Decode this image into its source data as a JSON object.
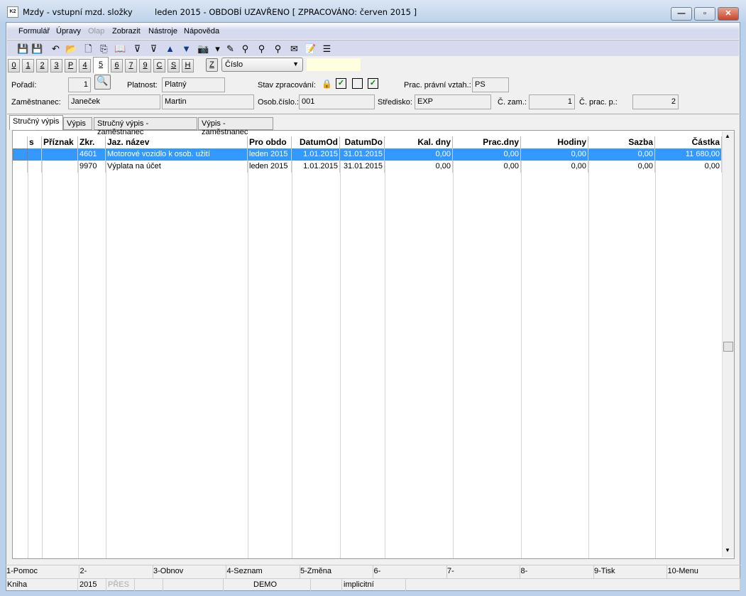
{
  "window": {
    "title": "Mzdy - vstupní mzd. složky",
    "status": "leden 2015 - OBDOBÍ UZAVŘENO [ ZPRACOVÁNO: červen 2015 ]",
    "logo": "K2",
    "min": "—",
    "max": "▫",
    "close": "✕"
  },
  "menu": [
    {
      "label": "Formulář",
      "enabled": true
    },
    {
      "label": "Úpravy",
      "enabled": true
    },
    {
      "label": "Olap",
      "enabled": false
    },
    {
      "label": "Zobrazit",
      "enabled": true
    },
    {
      "label": "Nástroje",
      "enabled": true
    },
    {
      "label": "Nápověda",
      "enabled": true
    }
  ],
  "toolbar": [
    {
      "icon": "save-icon",
      "glyph": "💾"
    },
    {
      "icon": "save-as-icon",
      "glyph": "💾"
    },
    {
      "icon": "undo-icon",
      "glyph": "↶"
    },
    {
      "icon": "open-folder-icon",
      "glyph": "📂"
    },
    {
      "icon": "new-document-icon",
      "glyph": "🗋"
    },
    {
      "icon": "copy-icon",
      "glyph": "⎘"
    },
    {
      "icon": "book-icon",
      "glyph": "📖"
    },
    {
      "icon": "filter-icon",
      "glyph": "⊽"
    },
    {
      "icon": "filter-list-icon",
      "glyph": "⊽"
    },
    {
      "icon": "arrow-up-icon",
      "glyph": "▲"
    },
    {
      "icon": "arrow-down-icon",
      "glyph": "▼"
    },
    {
      "icon": "camera-icon",
      "glyph": "📷"
    },
    {
      "icon": "dropdown-icon",
      "glyph": "▾"
    },
    {
      "icon": "excel-icon",
      "glyph": "✎"
    },
    {
      "icon": "binoculars-icon",
      "glyph": "⚲"
    },
    {
      "icon": "binoculars-next-icon",
      "glyph": "⚲"
    },
    {
      "icon": "binoculars-prev-icon",
      "glyph": "⚲"
    },
    {
      "icon": "mail-icon",
      "glyph": "✉"
    },
    {
      "icon": "edit-folder-icon",
      "glyph": "📝"
    },
    {
      "icon": "menu-lines-icon",
      "glyph": "☰"
    }
  ],
  "num_tabs": [
    "0",
    "1",
    "2",
    "3",
    "P",
    "4",
    "5",
    "6",
    "7",
    "9",
    "C",
    "S",
    "H"
  ],
  "active_num_tab": "5",
  "z_button": "Z",
  "sort_select": {
    "value": "Číslo"
  },
  "yellow_field": "",
  "form": {
    "poradi_label": "Pořadí:",
    "poradi": "1",
    "platnost_label": "Platnost:",
    "platnost": "Platný",
    "stav_label": "Stav zpracování:",
    "prac_vztah_label": "Prac. právní vztah.:",
    "prac_vztah": "PS",
    "zamestnanec_label": "Zaměstnanec:",
    "prijmeni": "Janeček",
    "jmeno": "Martin",
    "osob_label": "Osob.číslo.:",
    "osob": "001",
    "stredisko_label": "Středisko:",
    "stredisko": "EXP",
    "czam_label": "Č. zam.:",
    "czam": "1",
    "cprac_label": "Č. prac. p.:",
    "cprac": "2"
  },
  "inner_tabs": [
    "Stručný výpis",
    "Výpis",
    "Stručný výpis - zaměstnanec",
    "Výpis - zaměstnanec"
  ],
  "grid": {
    "columns": [
      "",
      "s",
      "Příznak",
      "Zkr.",
      "Jaz. název",
      "Pro obdo",
      "DatumOd",
      "DatumDo",
      "Kal. dny",
      "Prac.dny",
      "Hodiny",
      "Sazba",
      "Částka"
    ],
    "rows": [
      [
        "",
        "",
        "",
        "4601",
        "Motorové vozidlo k osob. užití",
        "leden 2015",
        "1.01.2015",
        "31.01.2015",
        "0,00",
        "0,00",
        "0,00",
        "0,00",
        "11 680,00"
      ],
      [
        "",
        "",
        "",
        "9970",
        "Výplata na účet",
        "leden 2015",
        "1.01.2015",
        "31.01.2015",
        "0,00",
        "0,00",
        "0,00",
        "0,00",
        "0,00"
      ]
    ],
    "selected_row": 0
  },
  "fkeys": [
    "1-Pomoc",
    "2-",
    "3-Obnov",
    "4-Seznam",
    "5-Změna",
    "6-",
    "7-",
    "8-",
    "9-Tisk",
    "10-Menu"
  ],
  "statusbar": [
    "Kniha",
    "2015",
    "PŘES",
    "",
    "",
    "DEMO",
    "",
    "implicitní",
    ""
  ],
  "colors": {
    "selection": "#3399ff",
    "titlebar": "#bcd2ea"
  }
}
